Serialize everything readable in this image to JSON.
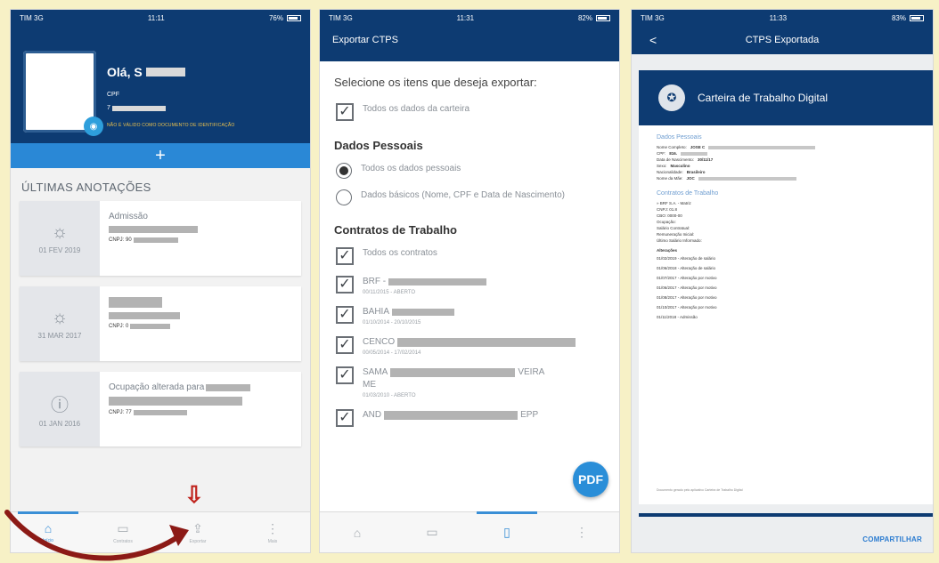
{
  "status": {
    "p1": {
      "carrier": "TIM 3G",
      "time": "11:11",
      "battery": "76%"
    },
    "p2": {
      "carrier": "TIM 3G",
      "time": "11:31",
      "battery": "82%"
    },
    "p3": {
      "carrier": "TIM 3G",
      "time": "11:33",
      "battery": "83%"
    }
  },
  "phone1": {
    "greeting": "Olá, S",
    "cpf_label": "CPF",
    "cpf_value": "7",
    "id_note": "NÃO É VÁLIDO COMO DOCUMENTO DE IDENTIFICAÇÃO",
    "add": "+",
    "section_title": "ÚLTIMAS ANOTAÇÕES",
    "cards": [
      {
        "date": "01 FEV 2019",
        "title": "Admissão",
        "line": "CNPJ: 90"
      },
      {
        "date": "31 MAR 2017",
        "title": "",
        "line": "CNPJ: 0"
      },
      {
        "date": "01 JAN 2016",
        "title": "Ocupação alterada para",
        "line": "CNPJ: 77"
      }
    ],
    "tabs": [
      "Início",
      "Contratos",
      "Exportar",
      "Mais"
    ],
    "arrow": "⇩"
  },
  "phone2": {
    "title": "Exportar CTPS",
    "question": "Selecione os itens que deseja exportar:",
    "all_data": "Todos os dados da carteira",
    "personal_title": "Dados Pessoais",
    "personal_all": "Todos os dados pessoais",
    "personal_basic": "Dados básicos (Nome, CPF e Data de Nascimento)",
    "contracts_title": "Contratos de Trabalho",
    "contracts_all": "Todos os contratos",
    "contracts": [
      {
        "name": "BRF -",
        "date": "00/11/2015 - ABERTO"
      },
      {
        "name": "BAHIA",
        "date": "01/10/2014 - 20/10/2015"
      },
      {
        "name": "CENCO",
        "date": "00/05/2014 - 17/02/2014"
      },
      {
        "name": "SAMA",
        "extra": "ME",
        "suffix": "VEIRA",
        "date": "01/03/2010 - ABERTO"
      },
      {
        "name": "AND",
        "suffix": "EPP",
        "date": ""
      }
    ],
    "fab_label": "PDF"
  },
  "phone3": {
    "back": "<",
    "title": "CTPS Exportada",
    "doc_title": "Carteira de Trabalho Digital",
    "personal_section": "Dados Pessoais",
    "personal_lines": [
      {
        "k": "Nome Completo:",
        "v": "JOSE C"
      },
      {
        "k": "CPF:",
        "v": "816."
      },
      {
        "k": "Data de Nascimento:",
        "v": "30/11/17"
      },
      {
        "k": "Sexo:",
        "v": "Masculino"
      },
      {
        "k": "Nacionalidade:",
        "v": "Brasileiro"
      },
      {
        "k": "Nome da Mãe:",
        "v": "JOC"
      }
    ],
    "contracts_section": "Contratos de Trabalho",
    "contract_lines": [
      "» BRF S.A. - Matriz",
      "CNPJ: 01.8",
      "CBO: 0000-00",
      "Ocupação:",
      "Salário Contratual:",
      "Remuneração Inicial:",
      "Último Salário Informado:"
    ],
    "history_title": "Alterações",
    "history_lines": [
      "01/02/2019 - Alteração de salário",
      "01/06/2018 - Alteração de salário",
      "01/07/2017 - Alteração por motivo",
      "01/06/2017 - Alteração por motivo",
      "01/08/2017 - Alteração por motivo",
      "01/10/2017 - Alteração por motivo",
      "01/11/2018 - Admissão"
    ],
    "footer": "Documento gerado pelo aplicativo Carteira de Trabalho Digital",
    "share": "COMPARTILHAR"
  }
}
